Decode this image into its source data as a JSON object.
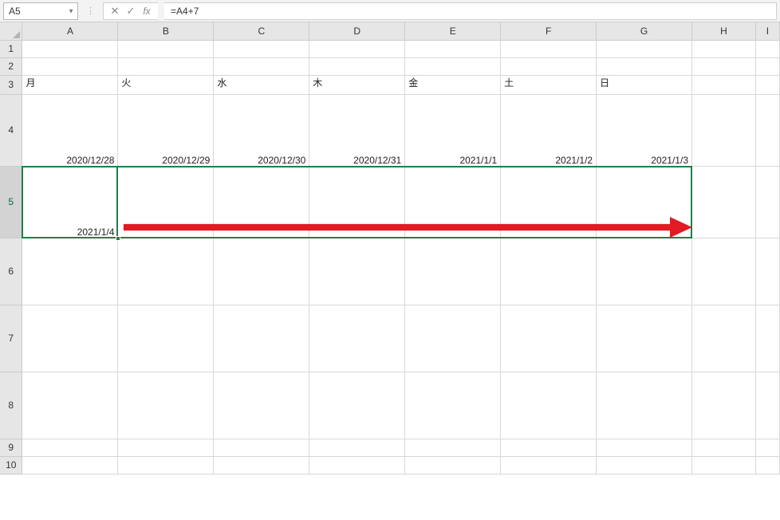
{
  "formula_bar": {
    "cell_ref": "A5",
    "cancel_icon": "✕",
    "confirm_icon": "✓",
    "fx_label": "fx",
    "formula": "=A4+7"
  },
  "columns": [
    "A",
    "B",
    "C",
    "D",
    "E",
    "F",
    "G",
    "H",
    "I"
  ],
  "rows": [
    "1",
    "2",
    "3",
    "4",
    "5",
    "6",
    "7",
    "8",
    "9",
    "10"
  ],
  "grid": {
    "r3": {
      "A": "月",
      "B": "火",
      "C": "水",
      "D": "木",
      "E": "金",
      "F": "土",
      "G": "日"
    },
    "r4": {
      "A": "2020/12/28",
      "B": "2020/12/29",
      "C": "2020/12/30",
      "D": "2020/12/31",
      "E": "2021/1/1",
      "F": "2021/1/2",
      "G": "2021/1/3"
    },
    "r5": {
      "A": "2021/1/4"
    }
  },
  "selection": {
    "active_cell": "A5",
    "range": "A5:G5"
  }
}
